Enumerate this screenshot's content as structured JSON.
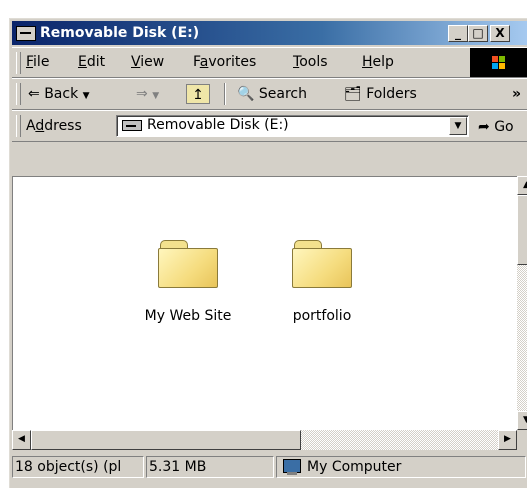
{
  "window": {
    "title": "Removable Disk (E:)"
  },
  "title_buttons": {
    "minimize": "_",
    "maximize": "□",
    "close": "X"
  },
  "menu": [
    {
      "label": "File",
      "key": "F",
      "rest": "ile"
    },
    {
      "label": "Edit",
      "key": "E",
      "rest": "dit"
    },
    {
      "label": "View",
      "key": "V",
      "rest": "iew"
    },
    {
      "label": "Favorites",
      "pre": "F",
      "key": "a",
      "rest": "vorites"
    },
    {
      "label": "Tools",
      "key": "T",
      "rest": "ools"
    },
    {
      "label": "Help",
      "key": "H",
      "rest": "elp"
    }
  ],
  "toolbar": {
    "back_label": "Back",
    "search_label": "Search",
    "folders_label": "Folders",
    "more": "»"
  },
  "address": {
    "label_pre": "A",
    "label_key": "d",
    "label_rest": "dress",
    "value": "Removable Disk (E:)",
    "go_label": "Go"
  },
  "folders": [
    {
      "name": "My Web Site"
    },
    {
      "name": "portfolio"
    }
  ],
  "status": {
    "objects": "18 object(s) (pl",
    "size": "5.31 MB",
    "location": "My Computer"
  },
  "colors": {
    "title_gradient_start": "#0a246a",
    "title_gradient_end": "#a6caf0",
    "chrome": "#d4d0c8",
    "folder_yellow": "#f5dc7e"
  },
  "icons": [
    "drive-icon",
    "windows-logo-icon",
    "back-arrow-icon",
    "forward-arrow-icon",
    "up-folder-icon",
    "search-icon",
    "folders-icon",
    "go-arrow-icon",
    "folder-icon",
    "computer-icon"
  ]
}
